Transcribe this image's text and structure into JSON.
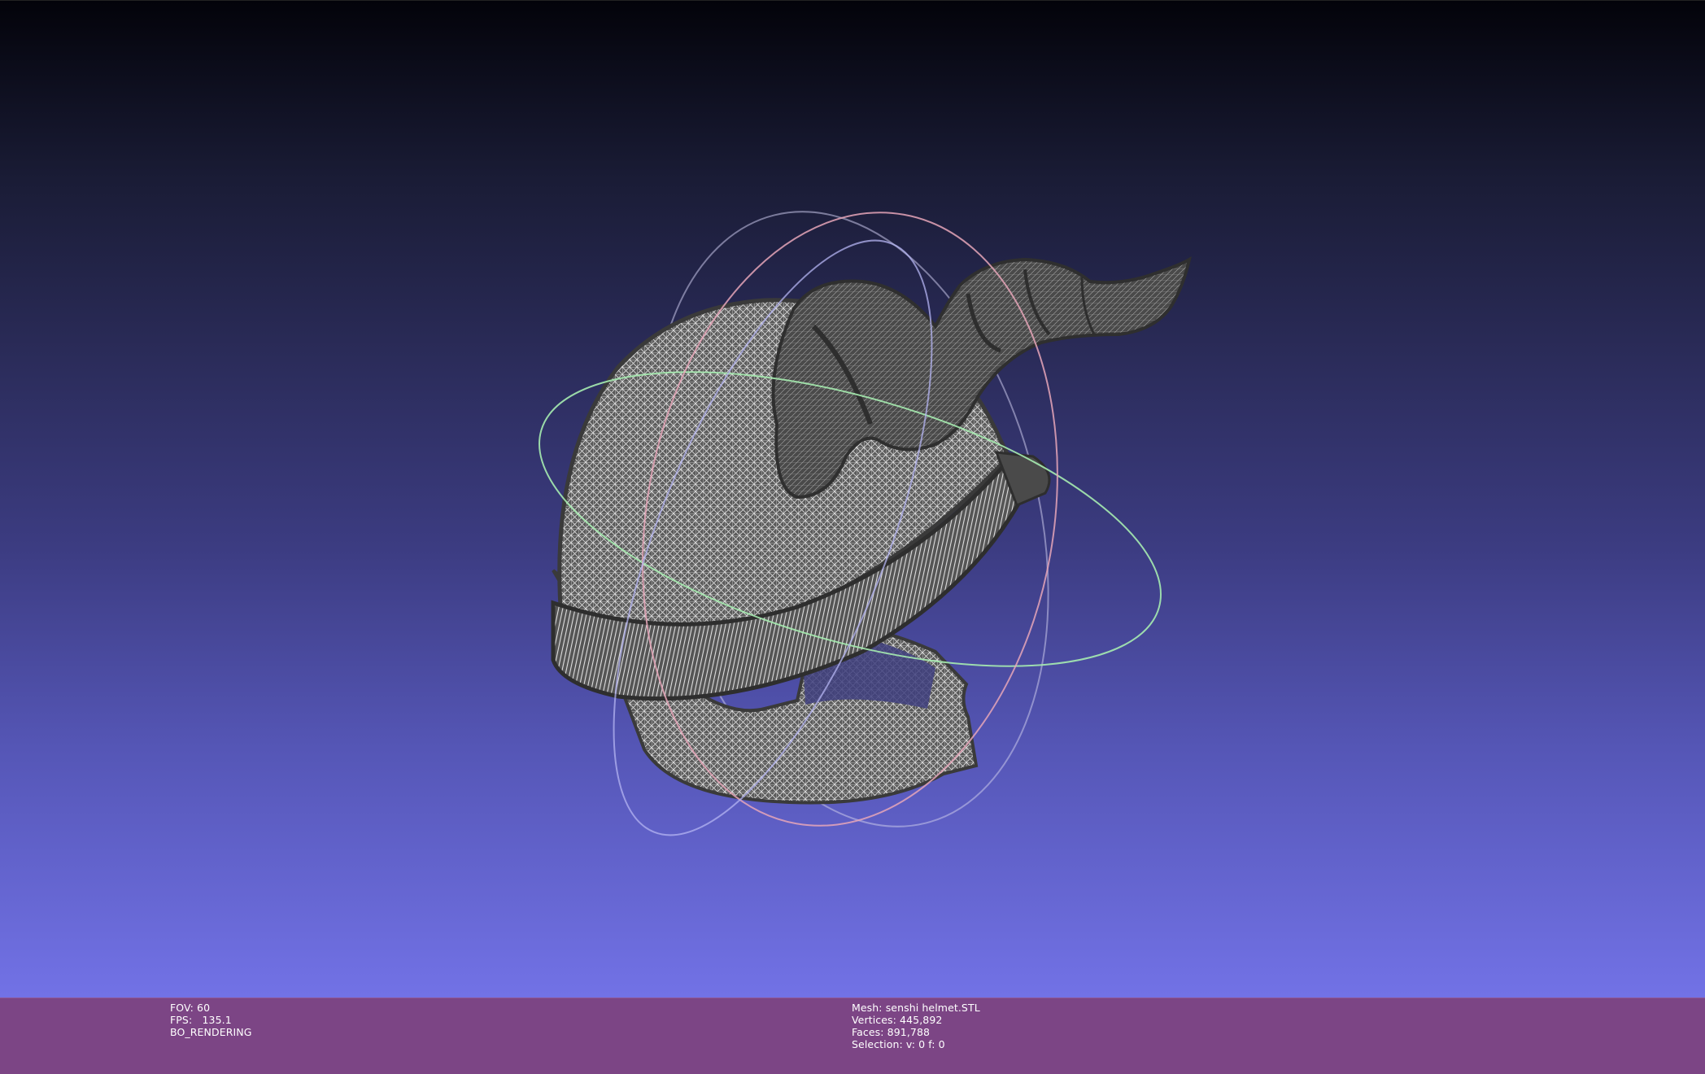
{
  "viewer": {
    "background_top_color": "#03030a",
    "background_bottom_color": "#7272e6",
    "mesh_color": "#5a5a5a",
    "wire_color": "#d9d9d9",
    "trackball_colors": {
      "x_ring": "#e6a6b8",
      "y_ring": "#a6ecb0",
      "z_ring": "#b4b4f2"
    }
  },
  "info_bar": {
    "background_color": "#7c4585",
    "left": {
      "fov": "FOV: 60",
      "fps": "FPS:   135.1",
      "render_mode": "BO_RENDERING"
    },
    "right": {
      "mesh": "Mesh: senshi helmet.STL",
      "vertices": "Vertices: 445,892",
      "faces": "Faces: 891,788",
      "selection": "Selection: v: 0 f: 0"
    }
  }
}
